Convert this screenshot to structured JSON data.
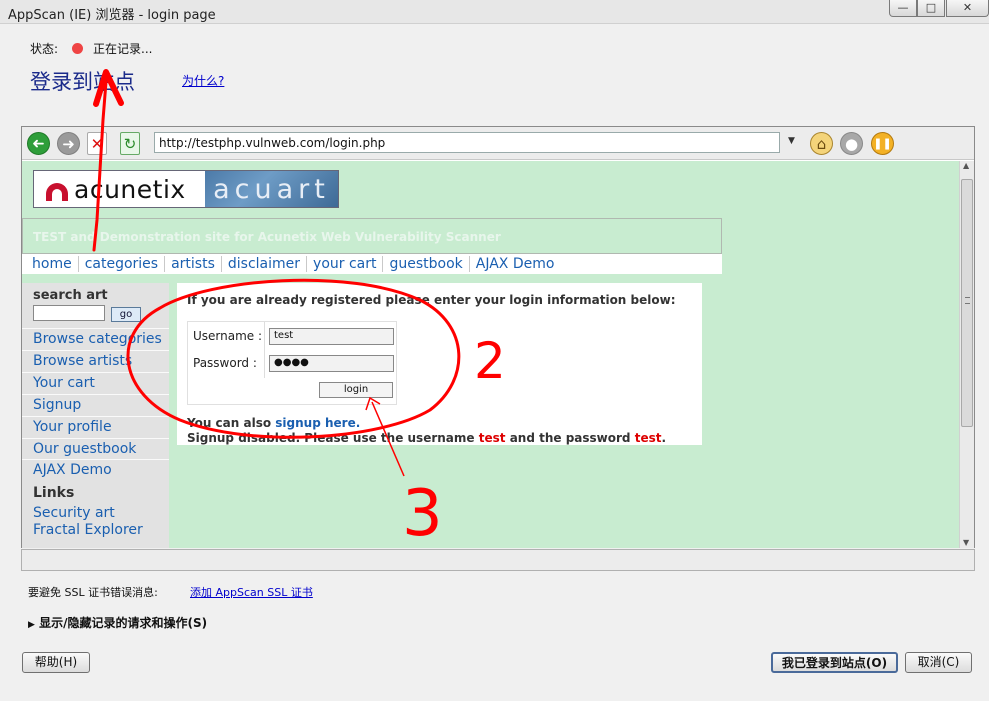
{
  "window": {
    "title": "AppScan (IE) 浏览器 - login page",
    "controls": {
      "minimize": "—",
      "maximize": "□",
      "close": "✕"
    }
  },
  "status": {
    "label": "状态:",
    "value": "正在记录..."
  },
  "heading": {
    "title": "登录到站点",
    "why_link": "为什么?"
  },
  "browser": {
    "url": "http://testphp.vulnweb.com/login.php",
    "buttons": {
      "back": "➜",
      "forward": "➜",
      "stop": "✕",
      "refresh": "↻",
      "home": "⌂",
      "record": "●",
      "pause": "❚❚"
    }
  },
  "site": {
    "logo": {
      "left": "acunetix",
      "right": "acuart"
    },
    "tagline": "TEST and Demonstration site for Acunetix Web Vulnerability Scanner",
    "nav": [
      "home",
      "categories",
      "artists",
      "disclaimer",
      "your cart",
      "guestbook",
      "AJAX Demo"
    ],
    "sidebar": {
      "search_title": "search art",
      "search_value": "",
      "go_label": "go",
      "items": [
        "Browse categories",
        "Browse artists",
        "Your cart",
        "Signup",
        "Your profile",
        "Our guestbook",
        "AJAX Demo"
      ],
      "links_title": "Links",
      "links": [
        "Security art",
        "Fractal Explorer"
      ]
    },
    "login": {
      "intro": "If you are already registered please enter your login information below:",
      "username_label": "Username :",
      "username_value": "test",
      "password_label": "Password :",
      "password_value": "●●●●",
      "login_button": "login",
      "signup_text": "You can also",
      "signup_link": "signup here.",
      "disabled_text_a": "Signup disabled. Please use the username",
      "disabled_user": "test",
      "disabled_text_b": "and the password",
      "disabled_pass": "test",
      "disabled_end": "."
    }
  },
  "ssl": {
    "text": "要避免 SSL 证书错误消息:",
    "link": "添加 AppScan SSL 证书"
  },
  "toggle": {
    "arrow": "▶",
    "label": "显示/隐藏记录的请求和操作(S)"
  },
  "dialog_buttons": {
    "help": "帮助(H)",
    "done": "我已登录到站点(O)",
    "cancel": "取消(C)"
  },
  "annotations": {
    "two": "2",
    "three": "3",
    "color": "#ff0000"
  }
}
